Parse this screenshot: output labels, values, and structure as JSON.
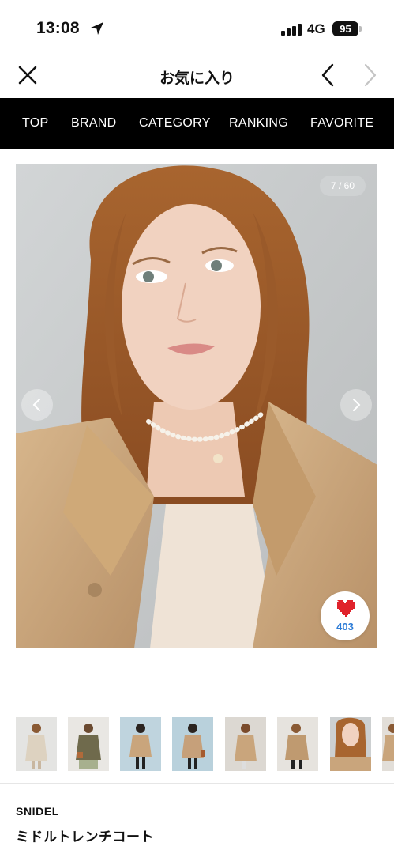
{
  "status_bar": {
    "time": "13:08",
    "network": "4G",
    "battery": "95"
  },
  "header": {
    "title": "お気に入り"
  },
  "nav": {
    "items": [
      "TOP",
      "BRAND",
      "CATEGORY",
      "RANKING",
      "FAVORITE"
    ]
  },
  "gallery": {
    "counter": "7 / 60",
    "favorite_count": "403",
    "thumbnail_count": 8
  },
  "product": {
    "brand": "SNIDEL",
    "name": "ミドルトレンチコート"
  },
  "colors": {
    "nav_bg": "#000000",
    "accent_blue": "#2b7bd6",
    "heart_red": "#e0222b",
    "coat_beige": "#c9a57c"
  }
}
